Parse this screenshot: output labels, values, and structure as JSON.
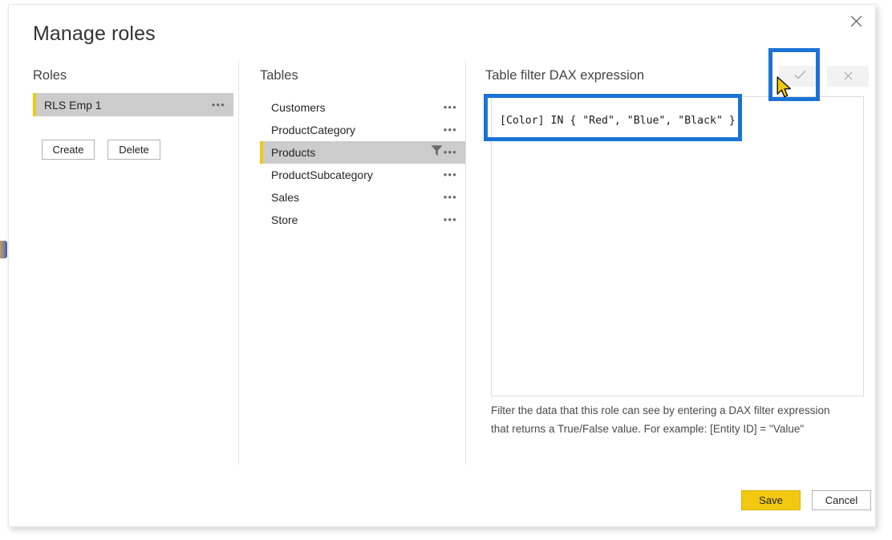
{
  "dialog": {
    "title": "Manage roles",
    "close_label": "×",
    "close_icon": "close-icon"
  },
  "roles": {
    "heading": "Roles",
    "items": [
      {
        "label": "RLS Emp 1",
        "selected": true,
        "menu_glyph": "•••"
      }
    ],
    "create_label": "Create",
    "delete_label": "Delete"
  },
  "tables": {
    "heading": "Tables",
    "items": [
      {
        "label": "Customers",
        "selected": false,
        "filtered": false,
        "menu_glyph": "•••"
      },
      {
        "label": "ProductCategory",
        "selected": false,
        "filtered": false,
        "menu_glyph": "•••"
      },
      {
        "label": "Products",
        "selected": true,
        "filtered": true,
        "menu_glyph": "•••"
      },
      {
        "label": "ProductSubcategory",
        "selected": false,
        "filtered": false,
        "menu_glyph": "•••"
      },
      {
        "label": "Sales",
        "selected": false,
        "filtered": false,
        "menu_glyph": "•••"
      },
      {
        "label": "Store",
        "selected": false,
        "filtered": false,
        "menu_glyph": "•••"
      }
    ]
  },
  "dax": {
    "heading": "Table filter DAX expression",
    "expression": "[Color] IN { \"Red\", \"Blue\", \"Black\" }",
    "placeholder": "",
    "accept_label": "✓",
    "cancel_label": "×",
    "accept_icon": "checkmark-icon",
    "cancel_icon": "close-icon",
    "hint_line_1": "Filter the data that this role can see by entering a DAX filter expression",
    "hint_line_2": "that returns a True/False value. For example: [Entity ID] = \"Value\""
  },
  "footer": {
    "save_label": "Save",
    "cancel_label": "Cancel"
  },
  "colors": {
    "accent_yellow": "#F2C811",
    "selection_gray": "#CCCCCC",
    "annotation_blue": "#1A73D4",
    "text_primary": "#252525",
    "text_heading": "#444444"
  }
}
